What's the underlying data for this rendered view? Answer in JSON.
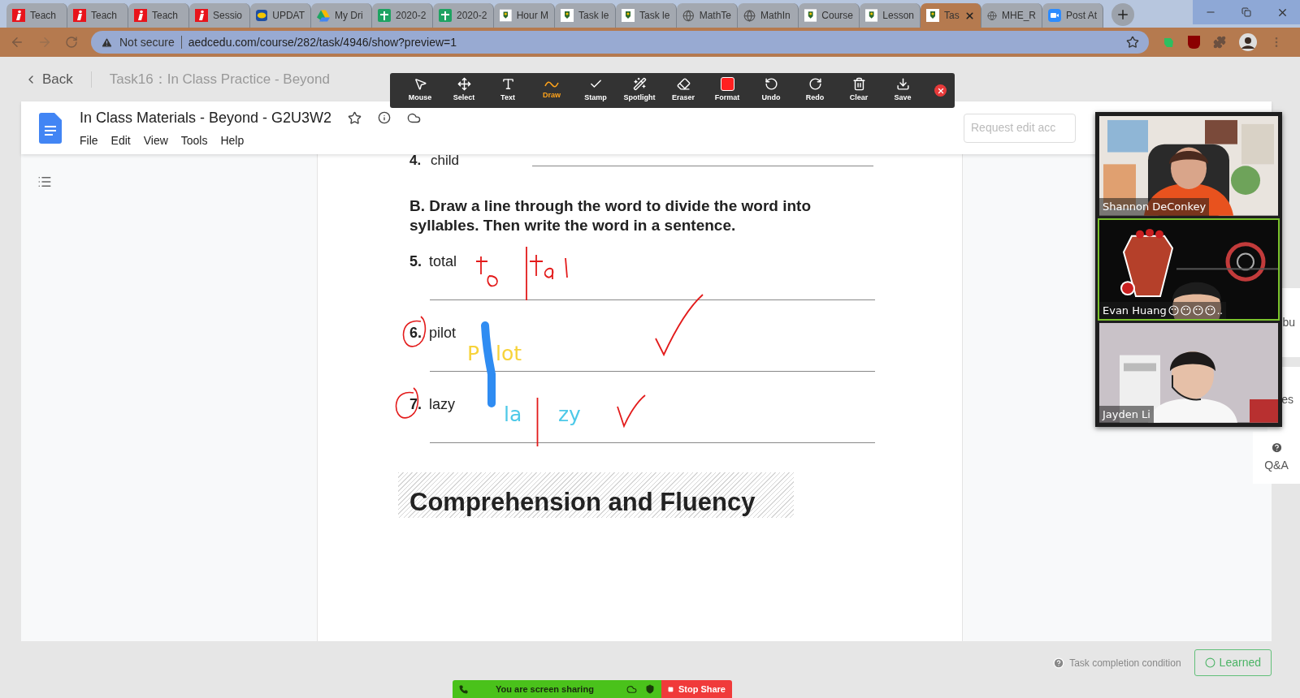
{
  "browser": {
    "tabs": [
      {
        "title": "Teach",
        "kind": "brand",
        "selected": false
      },
      {
        "title": "Teach",
        "kind": "brand",
        "selected": false
      },
      {
        "title": "Teach",
        "kind": "brand",
        "selected": false
      },
      {
        "title": "Sessio",
        "kind": "brand",
        "selected": false
      },
      {
        "title": "UPDAT",
        "kind": "badge",
        "selected": false
      },
      {
        "title": "My Dri",
        "kind": "drive",
        "selected": false
      },
      {
        "title": "2020-2",
        "kind": "sheet",
        "selected": false
      },
      {
        "title": "2020-2",
        "kind": "sheet",
        "selected": false
      },
      {
        "title": "Hour M",
        "kind": "school",
        "selected": false
      },
      {
        "title": "Task le",
        "kind": "school",
        "selected": false
      },
      {
        "title": "Task le",
        "kind": "school",
        "selected": false
      },
      {
        "title": "MathTe",
        "kind": "web",
        "selected": false
      },
      {
        "title": "MathIn",
        "kind": "web",
        "selected": false
      },
      {
        "title": "Course",
        "kind": "school",
        "selected": false
      },
      {
        "title": "Lesson",
        "kind": "school",
        "selected": false
      },
      {
        "title": "Tas",
        "kind": "school",
        "selected": true
      },
      {
        "title": "MHE_R",
        "kind": "web",
        "selected": false
      },
      {
        "title": "Post At",
        "kind": "meeting",
        "selected": false
      }
    ],
    "security": "Not secure",
    "url": "aedcedu.com/course/282/task/4946/show?preview=1"
  },
  "page": {
    "back": "Back",
    "breadcrumb": "Task16：In Class Practice - Beyond"
  },
  "doc": {
    "title": "In Class Materials - Beyond - G2U3W2",
    "menu": [
      "File",
      "Edit",
      "View",
      "Tools",
      "Help"
    ],
    "request_field": {
      "placeholder": "Request edit acc"
    },
    "prev_item": {
      "number": "4.",
      "word": "child"
    },
    "instructions": "B. Draw a line through the word to divide the word into syllables. Then write the word in a sentence.",
    "items": [
      {
        "number": "5.",
        "word": "total",
        "circled": false
      },
      {
        "number": "6.",
        "word": "pilot",
        "circled": true
      },
      {
        "number": "7.",
        "word": "lazy",
        "circled": true
      }
    ],
    "annotations": [
      {
        "text": "P",
        "color": "#f7d33a"
      },
      {
        "text": "lot",
        "color": "#f7d33a"
      },
      {
        "text": "la",
        "color": "#4ec9e8"
      },
      {
        "text": "zy",
        "color": "#4ec9e8"
      }
    ],
    "section_title": "Comprehension and Fluency"
  },
  "annotation_toolbar": {
    "tools": [
      {
        "label": "Mouse",
        "kind": "mouse",
        "selected": false
      },
      {
        "label": "Select",
        "kind": "move",
        "selected": false
      },
      {
        "label": "Text",
        "kind": "text",
        "selected": false
      },
      {
        "label": "Draw",
        "kind": "draw",
        "selected": true
      },
      {
        "label": "Stamp",
        "kind": "check",
        "selected": false
      },
      {
        "label": "Spotlight",
        "kind": "wand",
        "selected": false
      },
      {
        "label": "Eraser",
        "kind": "eraser",
        "selected": false
      },
      {
        "label": "Format",
        "kind": "format",
        "selected": false
      },
      {
        "label": "Undo",
        "kind": "undo",
        "selected": false
      },
      {
        "label": "Redo",
        "kind": "redo",
        "selected": false
      },
      {
        "label": "Clear",
        "kind": "trash",
        "selected": false
      },
      {
        "label": "Save",
        "kind": "save",
        "selected": false
      }
    ]
  },
  "video_panel": [
    {
      "name": "Shannon DeConkey",
      "active": false,
      "emoji": false,
      "kind": "picture"
    },
    {
      "name": "Evan Huang",
      "active": true,
      "emoji": true,
      "suffix": "..",
      "kind": "picture"
    },
    {
      "name": "Jayden Li",
      "active": false,
      "emoji": false,
      "kind": "picture"
    }
  ],
  "side_tabs": [
    {
      "label": "bu"
    },
    {
      "label": "es"
    },
    {
      "label": "Q&A"
    }
  ],
  "footer": {
    "condition": "Task completion condition",
    "learned": "Learned"
  },
  "share_bar": {
    "status": "You are screen sharing",
    "stop": "Stop Share"
  }
}
